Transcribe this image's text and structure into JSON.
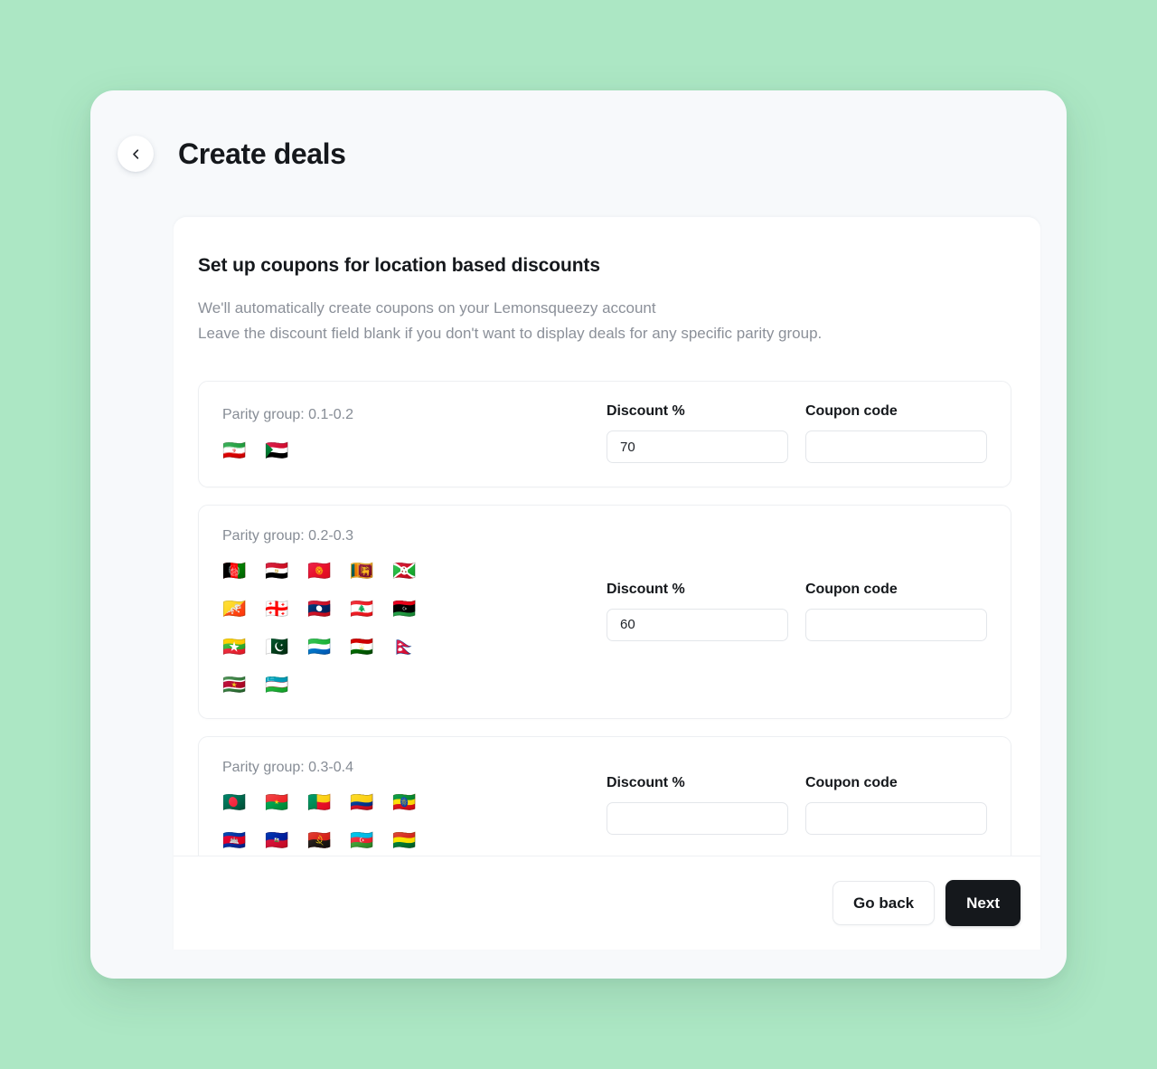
{
  "header": {
    "back_icon": "chevron-left-icon",
    "title": "Create deals"
  },
  "content": {
    "section_title": "Set up coupons for location based discounts",
    "description_line_1": "We'll automatically create coupons on your Lemonsqueezy account",
    "description_line_2": "Leave the discount field blank if you don't want to display deals for any specific parity group."
  },
  "field_labels": {
    "discount": "Discount %",
    "coupon": "Coupon code"
  },
  "groups": [
    {
      "label": "Parity group: 0.1-0.2",
      "discount_value": "70",
      "coupon_value": "",
      "coupon_placeholder": "",
      "flags": [
        "🇮🇷",
        "🇸🇩"
      ],
      "flag_names": [
        "iran-flag",
        "sudan-flag"
      ]
    },
    {
      "label": "Parity group: 0.2-0.3",
      "discount_value": "60",
      "coupon_value": "",
      "coupon_placeholder": "",
      "flags": [
        "🇦🇫",
        "🇪🇬",
        "🇰🇬",
        "🇱🇰",
        "🇧🇮",
        "🇧🇹",
        "🇬🇪",
        "🇱🇦",
        "🇱🇧",
        "🇱🇾",
        "🇲🇲",
        "🇵🇰",
        "🇸🇱",
        "🇹🇯",
        "🇳🇵",
        "🇸🇷",
        "🇺🇿"
      ],
      "flag_names": [
        "afghanistan-flag",
        "egypt-flag",
        "kyrgyzstan-flag",
        "sri-lanka-flag",
        "burundi-flag",
        "bhutan-flag",
        "georgia-flag",
        "laos-flag",
        "lebanon-flag",
        "libya-flag",
        "myanmar-flag",
        "pakistan-flag",
        "sierra-leone-flag",
        "tajikistan-flag",
        "nepal-flag",
        "suriname-flag",
        "uzbekistan-flag"
      ]
    },
    {
      "label": "Parity group: 0.3-0.4",
      "discount_value": "",
      "coupon_value": "",
      "coupon_placeholder": "",
      "flags": [
        "🇧🇩",
        "🇧🇫",
        "🇧🇯",
        "🇨🇴",
        "🇪🇹",
        "🇰🇭",
        "🇭🇹",
        "🇦🇴",
        "🇦🇿",
        "🇧🇴"
      ],
      "flag_names": [
        "bangladesh-flag",
        "burkina-faso-flag",
        "benin-flag",
        "colombia-flag",
        "ethiopia-flag",
        "cambodia-flag",
        "haiti-flag",
        "angola-flag",
        "azerbaijan-flag",
        "bolivia-flag"
      ]
    }
  ],
  "footer": {
    "go_back_label": "Go back",
    "next_label": "Next"
  },
  "colors": {
    "page_background": "#ace7c4",
    "shell_background": "#f7f9fb",
    "card_background": "#ffffff",
    "primary_button": "#15181c",
    "muted_text": "#8b9099",
    "border": "#edeff2"
  }
}
